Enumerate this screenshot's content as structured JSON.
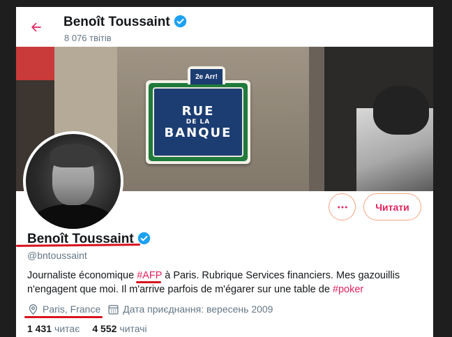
{
  "header": {
    "name": "Benoît Toussaint",
    "tweet_count": "8 076 твітів"
  },
  "banner": {
    "sign_arrondissement": "2e Arr!",
    "sign_line1": "RUE",
    "sign_line2": "DE LA",
    "sign_line3": "BANQUE"
  },
  "actions": {
    "more_icon": "more-horizontal-icon",
    "follow_label": "Читати"
  },
  "profile": {
    "name": "Benoît Toussaint",
    "handle": "@bntoussaint",
    "bio_part1": "Journaliste économique ",
    "bio_hashtag1": "#AFP",
    "bio_part2": " à Paris. Rubrique Services financiers. Mes gazouillis n'engagent que moi. Il m'arrive parfois de m'égarer sur une table de ",
    "bio_hashtag2": "#poker",
    "location": "Paris, France",
    "joined": "Дата приєднання: вересень 2009",
    "following_count": "1 431",
    "following_label": "читає",
    "followers_count": "4 552",
    "followers_label": "читачі"
  },
  "colors": {
    "accent": "#e0245e",
    "verified": "#1da1f2",
    "annotation_red": "#d8121d"
  }
}
